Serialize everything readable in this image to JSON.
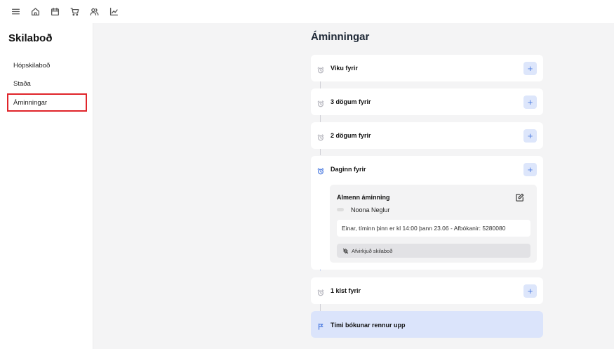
{
  "topbar": {
    "icons": [
      "menu-icon",
      "home-icon",
      "calendar-icon",
      "cart-icon",
      "users-icon",
      "chart-icon"
    ]
  },
  "sidebar": {
    "title": "Skilaboð",
    "items": [
      {
        "label": "Hópskilaboð"
      },
      {
        "label": "Staða"
      },
      {
        "label": "Áminningar",
        "active": true
      }
    ]
  },
  "main": {
    "title": "Áminningar",
    "reminders": [
      {
        "label": "Viku fyrir"
      },
      {
        "label": "3 dögum fyrir"
      },
      {
        "label": "2 dögum fyrir"
      },
      {
        "label": "Daginn fyrir",
        "expanded": true
      },
      {
        "label": "1 klst fyrir"
      }
    ],
    "plus_label": "+",
    "message": {
      "title": "Almenn áminning",
      "sender": "Noona Neglur",
      "text": "Einar, tíminn þinn er kl 14:00 þann 23.06 - Afbókanir: 5280080",
      "disable_label": "Afvirkjuð skilaboð"
    },
    "final": {
      "label": "Tími bókunar rennur upp"
    }
  },
  "colors": {
    "accent": "#4f7de0",
    "accent_light": "#dbe4fb",
    "active_outline": "#e0242a"
  }
}
